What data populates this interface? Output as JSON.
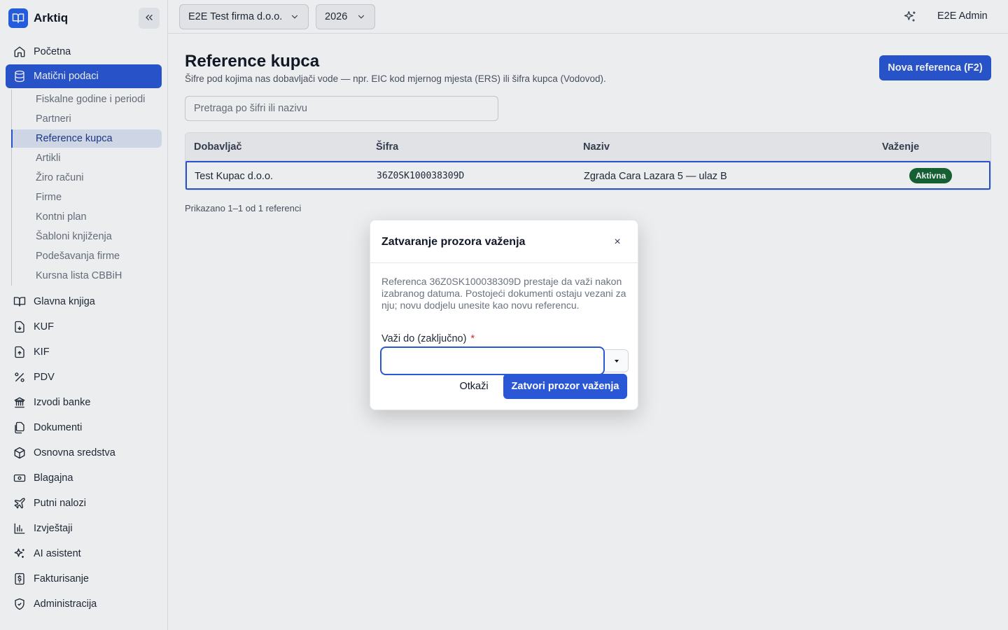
{
  "app": {
    "name": "Arktiq"
  },
  "sidebar": {
    "items": [
      {
        "label": "Početna",
        "icon": "home-icon"
      },
      {
        "label": "Matični podaci",
        "icon": "database-icon"
      },
      {
        "label": "Glavna knjiga",
        "icon": "book-icon"
      },
      {
        "label": "KUF",
        "icon": "file-download-icon"
      },
      {
        "label": "KIF",
        "icon": "file-upload-icon"
      },
      {
        "label": "PDV",
        "icon": "percent-icon"
      },
      {
        "label": "Izvodi banke",
        "icon": "bank-icon"
      },
      {
        "label": "Dokumenti",
        "icon": "documents-icon"
      },
      {
        "label": "Osnovna sredstva",
        "icon": "package-icon"
      },
      {
        "label": "Blagajna",
        "icon": "cash-icon"
      },
      {
        "label": "Putni nalozi",
        "icon": "plane-icon"
      },
      {
        "label": "Izvještaji",
        "icon": "bar-chart-icon"
      },
      {
        "label": "AI asistent",
        "icon": "sparkles-icon"
      },
      {
        "label": "Fakturisanje",
        "icon": "invoice-dollar-icon"
      },
      {
        "label": "Administracija",
        "icon": "shield-icon"
      }
    ],
    "subitems": [
      "Fiskalne godine i periodi",
      "Partneri",
      "Reference kupca",
      "Artikli",
      "Žiro računi",
      "Firme",
      "Kontni plan",
      "Šabloni knjiženja",
      "Podešavanja firme",
      "Kursna lista CBBiH"
    ]
  },
  "topbar": {
    "company": "E2E Test firma d.o.o.",
    "year": "2026",
    "user": "E2E Admin"
  },
  "page": {
    "title": "Reference kupca",
    "subtitle": "Šifre pod kojima nas dobavljači vode — npr. EIC kod mjernog mjesta (ERS) ili šifra kupca (Vodovod).",
    "new_button": "Nova referenca (F2)",
    "search_placeholder": "Pretraga po šifri ili nazivu"
  },
  "table": {
    "headers": [
      "Dobavljač",
      "Šifra",
      "Naziv",
      "Važenje"
    ],
    "rows": [
      {
        "supplier": "Test Kupac d.o.o.",
        "code": "36Z0SK100038309D",
        "name": "Zgrada Cara Lazara 5 — ulaz B",
        "status": "Aktivna"
      }
    ],
    "footer": "Prikazano 1–1 od 1 referenci"
  },
  "modal": {
    "title": "Zatvaranje prozora važenja",
    "close_symbol": "×",
    "description": "Referenca 36Z0SK100038309D prestaje da važi nakon izabranog datuma. Postojeći dokumenti ostaju vezani za nju; novu dodjelu unesite kao novu referencu.",
    "field_label": "Važi do (zaključno)",
    "required_mark": "*",
    "field_value": "",
    "cancel": "Otkaži",
    "confirm": "Zatvori prozor važenja"
  },
  "colors": {
    "accent": "#2a57d6",
    "active_badge": "#166534",
    "required": "#dc2626"
  }
}
